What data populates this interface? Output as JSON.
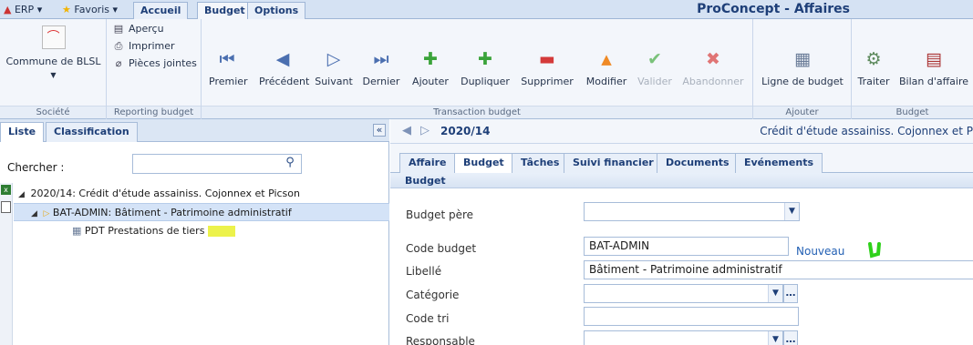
{
  "topbar": {
    "erp_label": "ERP ▾",
    "favoris_label": "Favoris ▾",
    "tabs": [
      "Accueil",
      "Budget",
      "Options"
    ],
    "app_title": "ProConcept - Affaires"
  },
  "ribbon": {
    "societe": {
      "button": "Commune de BLSL",
      "label": "Société"
    },
    "reporting": {
      "items": [
        "Aperçu",
        "Imprimer",
        "Pièces jointes"
      ],
      "label": "Reporting budget"
    },
    "transaction": {
      "label": "Transaction budget",
      "buttons": [
        "Premier",
        "Précédent",
        "Suivant",
        "Dernier",
        "Ajouter",
        "Dupliquer",
        "Supprimer",
        "Modifier",
        "Valider",
        "Abandonner"
      ]
    },
    "ajouter": {
      "button": "Ligne de budget",
      "label": "Ajouter"
    },
    "budget": {
      "buttons": [
        "Traiter",
        "Bilan d'affaire"
      ],
      "label": "Budget"
    }
  },
  "left": {
    "tabs": [
      "Liste",
      "Classification"
    ],
    "collapse_icon": "«",
    "search_label": "Chercher :",
    "search_value": "",
    "tree": [
      "2020/14: Crédit d'étude assainiss. Cojonnex et Picson",
      "BAT-ADMIN: Bâtiment - Patrimoine administratif",
      "PDT Prestations de tiers"
    ]
  },
  "right": {
    "record_id": "2020/14",
    "record_desc": "Crédit d'étude assainiss. Cojonnex et P",
    "tabs": [
      "Affaire",
      "Budget",
      "Tâches",
      "Suivi financier",
      "Documents",
      "Evénements"
    ],
    "section": "Budget",
    "fields": {
      "budget_pere": {
        "label": "Budget père",
        "value": ""
      },
      "code_budget": {
        "label": "Code budget",
        "value": "BAT-ADMIN"
      },
      "libelle": {
        "label": "Libellé",
        "value": "Bâtiment - Patrimoine administratif"
      },
      "categorie": {
        "label": "Catégorie",
        "value": ""
      },
      "code_tri": {
        "label": "Code tri",
        "value": ""
      },
      "responsable": {
        "label": "Responsable",
        "value": ""
      }
    },
    "nouveau_link": "Nouveau"
  },
  "colors": {
    "accent": "#1e3f78",
    "ribbon_bg": "#f3f6fb",
    "highlight": "#ecf24b",
    "mark": "#2fd11a"
  }
}
